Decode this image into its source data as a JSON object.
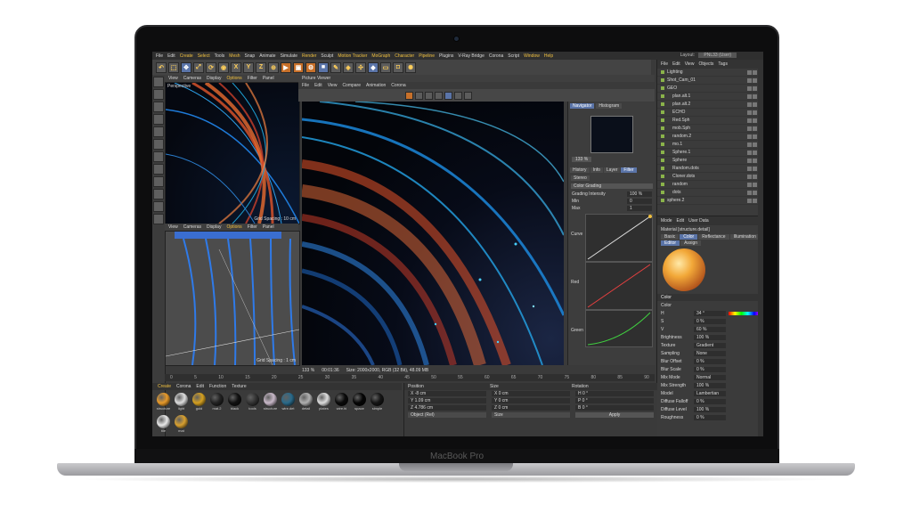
{
  "device": {
    "label": "MacBook Pro"
  },
  "menu": {
    "items": [
      "File",
      "Edit",
      "Create",
      "Select",
      "Tools",
      "Mesh",
      "Snap",
      "Animate",
      "Simulate",
      "Render",
      "Sculpt",
      "Motion Tracker",
      "MoGraph",
      "Character",
      "Pipeline",
      "Plugins",
      "V-Ray Bridge",
      "Corona",
      "Script",
      "Window",
      "Help"
    ],
    "layout_label": "Layout:",
    "layout_value": "PNL33 (User)"
  },
  "viewport1": {
    "menu": [
      "View",
      "Cameras",
      "Display",
      "Options",
      "Filter",
      "Panel"
    ],
    "label": "Perspective",
    "footer": "Grid Spacing : 10 cm"
  },
  "viewport2": {
    "menu": [
      "View",
      "Cameras",
      "Display",
      "Options",
      "Filter",
      "Panel"
    ],
    "footer": "Grid Spacing : 1 cm",
    "frame_fields": [
      "0 F",
      "90 F"
    ]
  },
  "picture_viewer": {
    "title": "Picture Viewer",
    "menu": [
      "File",
      "Edit",
      "View",
      "Compare",
      "Animation",
      "Corona"
    ],
    "status_zoom": "133 %",
    "status_time": "00:01:36",
    "status_size": "Size: 2000x2000, RGB (32 Bit), 48.09 MB"
  },
  "navigator": {
    "tabs": [
      "Navigator",
      "Histogram"
    ],
    "zoom": "133 %",
    "filter_tabs": [
      "History",
      "Info",
      "Layer",
      "Filter"
    ],
    "stack": "Stereo",
    "color_grading": "Color Grading",
    "rows": [
      {
        "label": "Grading Intensity",
        "value": "100 %"
      },
      {
        "label": "Min",
        "value": "0"
      },
      {
        "label": "Max",
        "value": "1"
      }
    ],
    "graphs": [
      "Curve",
      "Red",
      "Green"
    ]
  },
  "objects": {
    "menu": [
      "File",
      "Edit",
      "View",
      "Objects",
      "Tags"
    ],
    "items": [
      {
        "name": "Lighting",
        "sub": false
      },
      {
        "name": "Shot_Cam_01",
        "sub": false
      },
      {
        "name": "GEO",
        "sub": false
      },
      {
        "name": "plan.alt.1",
        "sub": true
      },
      {
        "name": "plan.alt.2",
        "sub": true
      },
      {
        "name": "ECHO",
        "sub": true
      },
      {
        "name": "Red.Sph",
        "sub": true
      },
      {
        "name": "mob.Sph",
        "sub": true
      },
      {
        "name": "random.2",
        "sub": true
      },
      {
        "name": "mo.1",
        "sub": true
      },
      {
        "name": "Sphere.1",
        "sub": true
      },
      {
        "name": "Sphere",
        "sub": true
      },
      {
        "name": "Random.dots",
        "sub": true
      },
      {
        "name": "Cloner.dots",
        "sub": true
      },
      {
        "name": "random",
        "sub": true
      },
      {
        "name": "dots",
        "sub": true
      },
      {
        "name": "sphere.2",
        "sub": false
      }
    ]
  },
  "attributes": {
    "menu": [
      "Mode",
      "Edit",
      "User Data"
    ],
    "material": "Material [structure.detail]",
    "tabs": [
      "Basic",
      "Color",
      "Reflectance",
      "Illumination",
      "Editor",
      "Assign"
    ],
    "section": "Color",
    "rows": [
      {
        "label": "Color",
        "value": ""
      },
      {
        "label": "H",
        "value": "34 °"
      },
      {
        "label": "S",
        "value": "0 %"
      },
      {
        "label": "V",
        "value": "60 %"
      },
      {
        "label": "Brightness",
        "value": "100 %"
      },
      {
        "label": "Texture",
        "value": "Gradient"
      },
      {
        "label": "Sampling",
        "value": "None"
      },
      {
        "label": "Blur Offset",
        "value": "0 %"
      },
      {
        "label": "Blur Scale",
        "value": "0 %"
      },
      {
        "label": "Mix Mode",
        "value": "Normal"
      },
      {
        "label": "Mix Strength",
        "value": "100 %"
      },
      {
        "label": "Model",
        "value": "Lambertian"
      },
      {
        "label": "Diffuse Falloff",
        "value": "0 %"
      },
      {
        "label": "Diffuse Level",
        "value": "100 %"
      },
      {
        "label": "Roughness",
        "value": "0 %"
      }
    ]
  },
  "timeline": {
    "ticks": [
      "0",
      "5",
      "10",
      "15",
      "20",
      "25",
      "30",
      "35",
      "40",
      "45",
      "50",
      "55",
      "60",
      "65",
      "70",
      "75",
      "80",
      "85",
      "90"
    ]
  },
  "material_manager": {
    "menu": [
      "Create",
      "Corona",
      "Edit",
      "Function",
      "Texture"
    ],
    "materials": [
      {
        "name": "structure",
        "color": "#e89a2a"
      },
      {
        "name": "light",
        "color": "#dddddd"
      },
      {
        "name": "gold",
        "color": "#d4a021"
      },
      {
        "name": "mat.2",
        "color": "#222222"
      },
      {
        "name": "black",
        "color": "#111111"
      },
      {
        "name": "tools",
        "color": "#333333"
      },
      {
        "name": "structure",
        "color": "#c8b8c8"
      },
      {
        "name": "wire.det",
        "color": "#2a6a8a"
      },
      {
        "name": "detail",
        "color": "#b0b0b0"
      },
      {
        "name": "plates",
        "color": "#dddddd"
      },
      {
        "name": "wire.hi",
        "color": "#0a0a0a"
      },
      {
        "name": "space",
        "color": "#050505"
      },
      {
        "name": "simple",
        "color": "#151515"
      },
      {
        "name": "tile",
        "color": "#e8e8e8"
      },
      {
        "name": "mat",
        "color": "#d8a030"
      }
    ]
  },
  "coordinates": {
    "headers": [
      "Position",
      "Size",
      "Rotation"
    ],
    "rows": [
      [
        "X  -8 cm",
        "X  0 cm",
        "H  0 °"
      ],
      [
        "Y  1.09 cm",
        "Y  0 cm",
        "P  0 °"
      ],
      [
        "Z  4.786 cm",
        "Z  0 cm",
        "B  0 °"
      ]
    ],
    "mode": "Object (Rel)",
    "size_mode": "Size",
    "apply": "Apply"
  }
}
